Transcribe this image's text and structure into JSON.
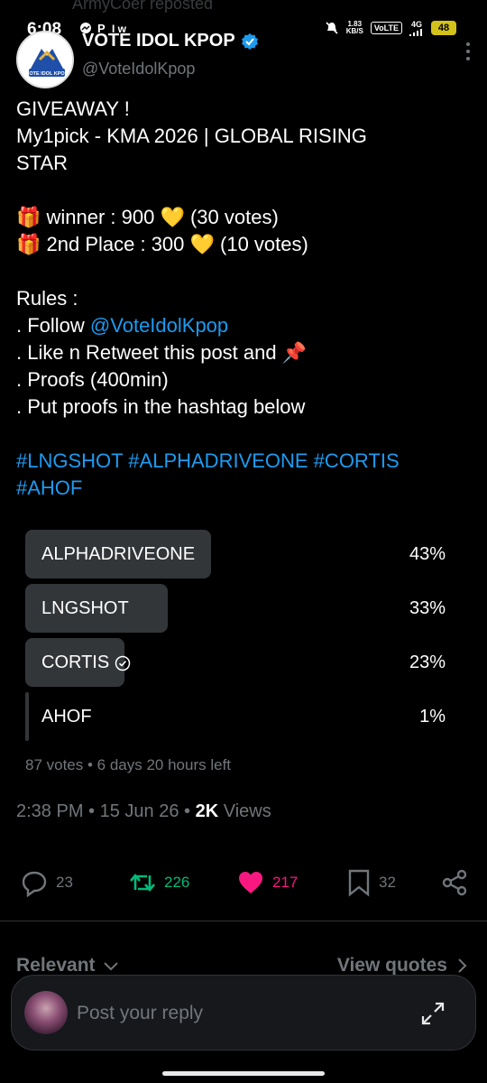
{
  "status_bar": {
    "time": "6:08",
    "speed_value": "1.83",
    "speed_unit": "KB/S",
    "volte": "VoLTE",
    "network": "4G",
    "battery": "48"
  },
  "reposted_label": "ArmyCoer reposted",
  "author": {
    "display_name": "VOTE IDOL KPOP",
    "handle": "@VoteIdolKpop",
    "logo_text": "VOTE IDOL KPOP"
  },
  "tweet": {
    "line1": "GIVEAWAY !",
    "line2": "My1pick - KMA 2026 | GLOBAL RISING",
    "line3": "STAR",
    "prize1": "🎁 winner : 900 💛 (30 votes)",
    "prize2": "🎁 2nd Place : 300 💛 (10 votes)",
    "rules_title": "Rules :",
    "rule1_prefix": ". Follow ",
    "rule1_mention": "@VoteIdolKpop",
    "rule2": ". Like n Retweet this post and 📌",
    "rule3": ". Proofs (400min)",
    "rule4": ". Put proofs in the hashtag below",
    "hashtags_line1": "#LNGSHOT #ALPHADRIVEONE  #CORTIS",
    "hashtags_line2": "#AHOF"
  },
  "poll": {
    "options": [
      {
        "label": "ALPHADRIVEONE",
        "percent_text": "43%",
        "share": 0.43
      },
      {
        "label": "LNGSHOT",
        "percent_text": "33%",
        "share": 0.33
      },
      {
        "label": "CORTIS",
        "percent_text": "23%",
        "share": 0.23,
        "selected": true
      },
      {
        "label": "AHOF",
        "percent_text": "1%",
        "share": 0.01
      }
    ],
    "meta": "87 votes • 6 days 20 hours left"
  },
  "timestamp": {
    "time_date": "2:38 PM • 15 Jun 26 • ",
    "views_count": "2K",
    "views_label": " Views"
  },
  "actions": {
    "replies": "23",
    "retweets": "226",
    "likes": "217",
    "bookmarks": "32"
  },
  "colors": {
    "accent": "#1d9bf0",
    "retweet": "#00ba7c",
    "like": "#f91880",
    "muted": "#71767b"
  },
  "replies_section": {
    "sort_label": "Relevant",
    "view_quotes": "View quotes"
  },
  "reply_input": {
    "placeholder": "Post your reply"
  }
}
